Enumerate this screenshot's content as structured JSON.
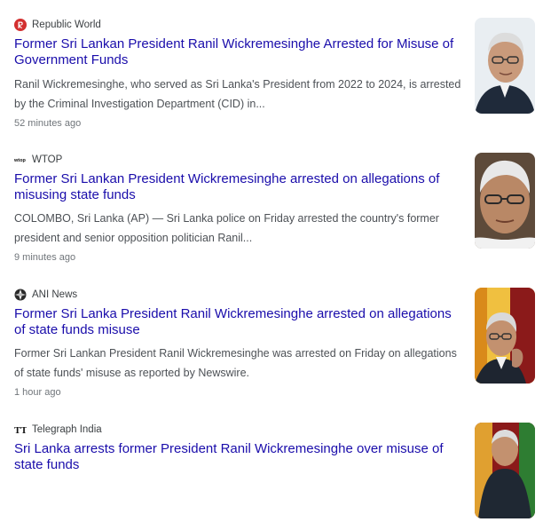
{
  "articles": [
    {
      "source": "Republic World",
      "source_icon": "republic-world-logo-icon",
      "headline": "Former Sri Lankan President Ranil Wickremesinghe Arrested for Misuse of Government Funds",
      "snippet": "Ranil Wickremesinghe, who served as Sri Lanka's President from 2022 to 2024, is arrested by the Criminal Investigation Department (CID) in...",
      "time": "52 minutes ago",
      "thumbnail": "portrait-photo-glasses"
    },
    {
      "source": "WTOP",
      "source_icon": "wtop-logo-icon",
      "headline": "Former Sri Lankan President Wickremesinghe arrested on allegations of misusing state funds",
      "snippet": "COLOMBO, Sri Lanka (AP) — Sri Lanka police on Friday arrested the country's former president and senior opposition politician Ranil...",
      "time": "9 minutes ago",
      "thumbnail": "portrait-photo-closeup"
    },
    {
      "source": "ANI News",
      "source_icon": "ani-news-logo-icon",
      "headline": "Former Sri Lanka President Ranil Wickremesinghe arrested on allegations of state funds misuse",
      "snippet": "Former Sri Lankan President Ranil Wickremesinghe was arrested on Friday on allegations of state funds' misuse as reported by Newswire.",
      "time": "1 hour ago",
      "thumbnail": "portrait-photo-flag"
    },
    {
      "source": "Telegraph India",
      "source_icon": "telegraph-india-logo-icon",
      "headline": "Sri Lanka arrests former President Ranil Wickremesinghe over misuse of state funds",
      "snippet": "",
      "time": "",
      "thumbnail": "portrait-photo-flag-2"
    }
  ],
  "colors": {
    "headline": "#1a0dab",
    "snippet": "#4d5156",
    "meta": "#70757a",
    "republic_red": "#d32f2f"
  }
}
